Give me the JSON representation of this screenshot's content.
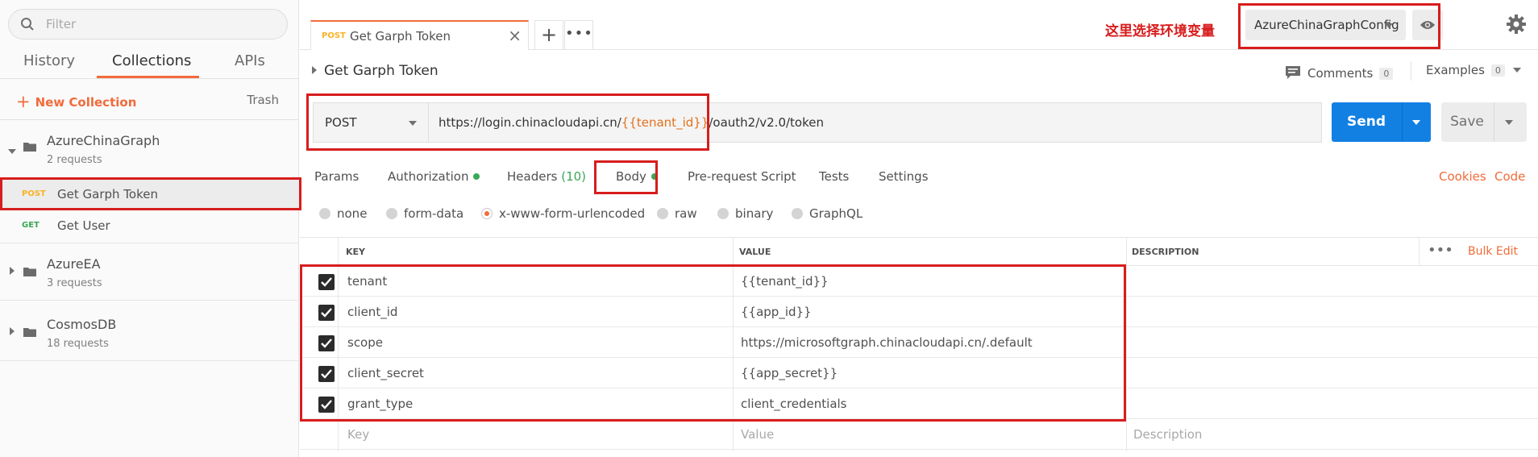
{
  "sidebar": {
    "search_placeholder": "Filter",
    "tabs": [
      {
        "label": "History"
      },
      {
        "label": "Collections"
      },
      {
        "label": "APIs"
      }
    ],
    "new_collection_label": "New Collection",
    "trash_label": "Trash",
    "collections": [
      {
        "name": "AzureChinaGraph",
        "count": "2 requests",
        "requests": [
          {
            "method": "POST",
            "name": "Get Garph Token"
          },
          {
            "method": "GET",
            "name": "Get User"
          }
        ]
      },
      {
        "name": "AzureEA",
        "count": "3 requests"
      },
      {
        "name": "CosmosDB",
        "count": "18 requests"
      }
    ]
  },
  "tabs_bar": {
    "tab_method": "POST",
    "tab_title": "Get Garph Token",
    "add_label": "+",
    "more_label": "•••"
  },
  "annotation": "这里选择环境变量",
  "environment": {
    "selected": "AzureChinaGraphConfig"
  },
  "request": {
    "title": "Get Garph Token",
    "comments_label": "Comments",
    "comments_count": "0",
    "examples_label": "Examples",
    "examples_count": "0",
    "method": "POST",
    "url_prefix": "https://login.chinacloudapi.cn/",
    "url_var": "{{tenant_id}}",
    "url_suffix": "/oauth2/v2.0/token",
    "send_label": "Send",
    "save_label": "Save"
  },
  "request_tabs": {
    "params": "Params",
    "authorization": "Authorization",
    "headers": "Headers",
    "headers_count": "(10)",
    "body": "Body",
    "prerequest": "Pre-request Script",
    "tests": "Tests",
    "settings": "Settings",
    "cookies": "Cookies",
    "code": "Code"
  },
  "body_types": [
    "none",
    "form-data",
    "x-www-form-urlencoded",
    "raw",
    "binary",
    "GraphQL"
  ],
  "body_type_selected": "x-www-form-urlencoded",
  "table": {
    "headers": {
      "key": "KEY",
      "value": "VALUE",
      "description": "DESCRIPTION"
    },
    "more_label": "•••",
    "bulk_edit": "Bulk Edit",
    "rows": [
      {
        "key": "tenant",
        "value": "{{tenant_id}}",
        "is_var": true
      },
      {
        "key": "client_id",
        "value": "{{app_id}}",
        "is_var": true
      },
      {
        "key": "scope",
        "value": "https://microsoftgraph.chinacloudapi.cn/.default",
        "is_var": false
      },
      {
        "key": "client_secret",
        "value": "{{app_secret}}",
        "is_var": true
      },
      {
        "key": "grant_type",
        "value": "client_credentials",
        "is_var": false
      }
    ],
    "placeholders": {
      "key": "Key",
      "value": "Value",
      "description": "Description"
    }
  },
  "colors": {
    "accent": "#f26b3a",
    "send": "#1280e3",
    "variable": "#e2711d",
    "annotation": "#d71d1d",
    "post": "#f7b223",
    "get": "#3aa757"
  },
  "icons": [
    "search-icon",
    "plus-icon",
    "folder-icon",
    "close-icon",
    "eye-icon",
    "gear-icon",
    "comment-icon",
    "checkbox-icon",
    "caret-icon"
  ]
}
